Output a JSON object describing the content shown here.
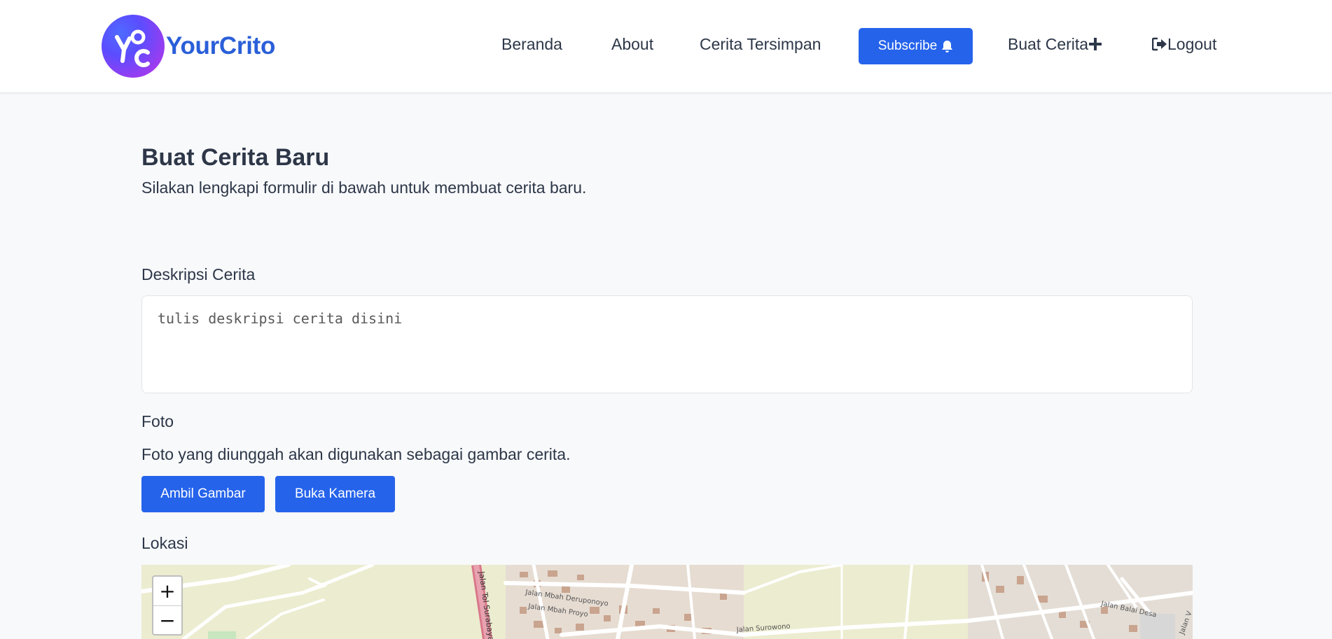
{
  "brand": {
    "name": "YourCrito",
    "logo_letters": "yc"
  },
  "nav": {
    "home": "Beranda",
    "about": "About",
    "saved": "Cerita Tersimpan",
    "subscribe": "Subscribe",
    "create": "Buat Cerita",
    "logout": "Logout"
  },
  "page": {
    "title": "Buat Cerita Baru",
    "subtitle": "Silakan lengkapi formulir di bawah untuk membuat cerita baru."
  },
  "form": {
    "description_label": "Deskripsi Cerita",
    "description_placeholder": "tulis deskripsi cerita disini",
    "photo_label": "Foto",
    "photo_help": "Foto yang diunggah akan digunakan sebagai gambar cerita.",
    "take_picture": "Ambil Gambar",
    "open_camera": "Buka Kamera",
    "location_label": "Lokasi"
  },
  "map": {
    "zoom_in": "+",
    "zoom_out": "−",
    "street_labels": [
      "Jalan Tol Surabaya",
      "Jalan Mbah Deruponoyo",
      "Jalan Mbah Proyo",
      "Jalan Surowono",
      "Jalan Balai Desa",
      "Jalan V"
    ]
  },
  "colors": {
    "primary": "#2563eb",
    "brand_text": "#2a5fd8",
    "text": "#2d3748",
    "background": "#f8f9fb"
  },
  "icons": [
    "bell-icon",
    "plus-icon",
    "logout-icon"
  ]
}
